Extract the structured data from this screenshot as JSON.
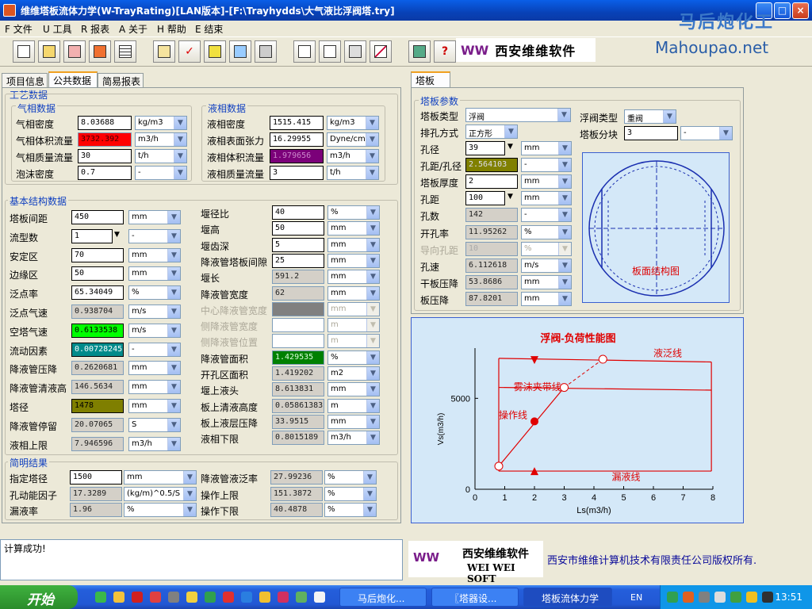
{
  "window": {
    "title": "维维塔板流体力学(W-TrayRating)[LAN版本]-[F:\\Trayhydds\\大气液比浮阀塔.try]",
    "btn_min": "_",
    "btn_max": "□",
    "btn_close": "×"
  },
  "watermark": {
    "line1": "马后炮化工",
    "line2": "Mahoupao.net"
  },
  "menu": [
    {
      "label": "F 文件"
    },
    {
      "label": "U 工具"
    },
    {
      "label": "R 报表"
    },
    {
      "label": "A 关于"
    },
    {
      "label": "H 帮助"
    },
    {
      "label": "E 结束"
    }
  ],
  "toolbar": {
    "icons": [
      "new-file-icon",
      "open-folder-icon",
      "print-file-icon",
      "export-icon",
      "table-icon",
      "load-icon",
      "check-icon",
      "settings-icon",
      "edit-icon",
      "tools-icon",
      "doc-icon",
      "copy-icon",
      "printer-icon",
      "chart-icon",
      "pen-icon",
      "help-icon"
    ],
    "help_glyph": "?",
    "brand_w": "WW",
    "brand_text": "西安维维软件"
  },
  "left_tabs": [
    {
      "label": "项目信息"
    },
    {
      "label": "公共数据"
    },
    {
      "label": "简易报表"
    }
  ],
  "process": {
    "title": "工艺数据",
    "gas": {
      "title": "气相数据",
      "rows": [
        {
          "label": "气相密度",
          "value": "8.03688",
          "unit": "kg/m3"
        },
        {
          "label": "气相体积流量",
          "value": "3732.392",
          "unit": "m3/h"
        },
        {
          "label": "气相质量流量",
          "value": "30",
          "unit": "t/h"
        },
        {
          "label": "泡沫密度",
          "value": "0.7",
          "unit": "-"
        }
      ]
    },
    "liquid": {
      "title": "液相数据",
      "rows": [
        {
          "label": "液相密度",
          "value": "1515.415",
          "unit": "kg/m3"
        },
        {
          "label": "液相表面张力",
          "value": "16.29955",
          "unit": "Dyne/cm"
        },
        {
          "label": "液相体积流量",
          "value": "1.979656",
          "unit": "m3/h"
        },
        {
          "label": "液相质量流量",
          "value": "3",
          "unit": "t/h"
        }
      ]
    }
  },
  "structure": {
    "title": "基本结构数据",
    "left": [
      {
        "label": "塔板间距",
        "value": "450",
        "unit": "mm"
      },
      {
        "label": "流型数",
        "value": "1",
        "unit": "-"
      },
      {
        "label": "安定区",
        "value": "70",
        "unit": "mm"
      },
      {
        "label": "边缘区",
        "value": "50",
        "unit": "mm"
      },
      {
        "label": "泛点率",
        "value": "65.34049",
        "unit": "%"
      },
      {
        "label": "泛点气速",
        "value": "0.938704",
        "unit": "m/s"
      },
      {
        "label": "空塔气速",
        "value": "0.6133538",
        "unit": "m/s"
      },
      {
        "label": "流动因素",
        "value": "0.007282457",
        "unit": "-"
      },
      {
        "label": "降液管压降",
        "value": "0.2620681",
        "unit": "mm"
      },
      {
        "label": "降液管清液高",
        "value": "146.5634",
        "unit": "mm"
      },
      {
        "label": "塔径",
        "value": "1478",
        "unit": "mm"
      },
      {
        "label": "降液管停留",
        "value": "20.07065",
        "unit": "S"
      },
      {
        "label": "液相上限",
        "value": "7.946596",
        "unit": "m3/h"
      }
    ],
    "right": [
      {
        "label": "堰径比",
        "value": "40",
        "unit": "%"
      },
      {
        "label": "堰高",
        "value": "50",
        "unit": "mm"
      },
      {
        "label": "堰齿深",
        "value": "5",
        "unit": "mm"
      },
      {
        "label": "降液管塔板间隙",
        "value": "25",
        "unit": "mm"
      },
      {
        "label": "堰长",
        "value": "591.2",
        "unit": "mm"
      },
      {
        "label": "降液管宽度",
        "value": "62",
        "unit": "mm"
      },
      {
        "label": "中心降液管宽度",
        "value": "",
        "unit": "mm"
      },
      {
        "label": "侧降液管宽度",
        "value": "",
        "unit": "m"
      },
      {
        "label": "侧降液管位置",
        "value": "",
        "unit": "m"
      },
      {
        "label": "降液管面积",
        "value": "1.429535",
        "unit": "%"
      },
      {
        "label": "开孔区面积",
        "value": "1.419202",
        "unit": "m2"
      },
      {
        "label": "堰上液头",
        "value": "8.613831",
        "unit": "mm"
      },
      {
        "label": "板上清液高度",
        "value": "0.05861383",
        "unit": "m"
      },
      {
        "label": "板上液层压降",
        "value": "33.9515",
        "unit": "mm"
      },
      {
        "label": "液相下限",
        "value": "0.8015189",
        "unit": "m3/h"
      }
    ]
  },
  "summary": {
    "title": "简明结果",
    "left": [
      {
        "label": "指定塔径",
        "value": "1500",
        "unit": "mm"
      },
      {
        "label": "孔动能因子",
        "value": "17.3289",
        "unit": "(kg/m)^0.5/S"
      },
      {
        "label": "漏液率",
        "value": "1.96",
        "unit": "%"
      }
    ],
    "right": [
      {
        "label": "降液管液泛率",
        "value": "27.99236",
        "unit": "%"
      },
      {
        "label": "操作上限",
        "value": "151.3872",
        "unit": "%"
      },
      {
        "label": "操作下限",
        "value": "40.4878",
        "unit": "%"
      }
    ]
  },
  "tray": {
    "tab": "塔板",
    "title": "塔板参数",
    "tray_type_label": "塔板类型",
    "tray_type": "浮阀",
    "valve_type_label": "浮阀类型",
    "valve_type": "重阀",
    "layout_label": "排孔方式",
    "layout": "正方形",
    "blocks_label": "塔板分块",
    "blocks": "3",
    "blocks_unit": "-",
    "rows": [
      {
        "label": "孔径",
        "value": "39",
        "unit": "mm"
      },
      {
        "label": "孔距/孔径",
        "value": "2.564103",
        "unit": "-"
      },
      {
        "label": "塔板厚度",
        "value": "2",
        "unit": "mm"
      },
      {
        "label": "孔距",
        "value": "100",
        "unit": "mm"
      },
      {
        "label": "孔数",
        "value": "142",
        "unit": "-"
      },
      {
        "label": "开孔率",
        "value": "11.95262",
        "unit": "%"
      },
      {
        "label": "导向孔距",
        "value": "10",
        "unit": "%"
      },
      {
        "label": "孔速",
        "value": "6.112618",
        "unit": "m/s"
      },
      {
        "label": "干板压降",
        "value": "53.8686",
        "unit": "mm"
      },
      {
        "label": "板压降",
        "value": "87.8201",
        "unit": "mm"
      }
    ],
    "diagram_label": "板面结构图"
  },
  "chart_data": {
    "type": "line",
    "title": "浮阀-负荷性能图",
    "xlabel": "Ls(m3/h)",
    "ylabel": "Vs(m3/h)",
    "xlim": [
      0,
      8
    ],
    "ylim": [
      0,
      7500
    ],
    "xticks": [
      0,
      1,
      2,
      3,
      4,
      5,
      6,
      7,
      8
    ],
    "yticks": [
      0,
      5000
    ],
    "series": [
      {
        "name": "液泛线",
        "x": [
          0.8,
          7.95
        ],
        "y": [
          7200,
          7000
        ]
      },
      {
        "name": "雾沫夹带线",
        "x": [
          0.8,
          7.95
        ],
        "y": [
          5600,
          5450
        ]
      },
      {
        "name": "漏液线",
        "x": [
          0.8,
          7.95
        ],
        "y": [
          1000,
          1000
        ]
      },
      {
        "name": "操作线",
        "x": [
          0.8,
          3.0
        ],
        "y": [
          1270,
          5600
        ]
      }
    ],
    "extension": {
      "x": [
        3.0,
        4.3
      ],
      "y": [
        5600,
        7150
      ]
    },
    "operating_point": {
      "x": 2.0,
      "y": 3732
    },
    "open_points": [
      {
        "x": 0.8,
        "y": 1270
      },
      {
        "x": 3.0,
        "y": 5600
      },
      {
        "x": 4.3,
        "y": 7150
      }
    ],
    "limit_markers": [
      {
        "x": 2.0,
        "y": 7100,
        "dir": "down"
      },
      {
        "x": 2.0,
        "y": 1000,
        "dir": "up"
      }
    ],
    "vlines": [
      {
        "x": 0.8,
        "y": [
          1000,
          7200
        ]
      },
      {
        "x": 7.95,
        "y": [
          1000,
          7000
        ]
      }
    ],
    "labels": [
      {
        "text": "液泛线",
        "x": 6.0,
        "y": 7300
      },
      {
        "text": "雾沫夹带线",
        "x": 1.3,
        "y": 5450
      },
      {
        "text": "操作线",
        "x": 0.8,
        "y": 3900
      },
      {
        "text": "漏液线",
        "x": 4.6,
        "y": 500
      }
    ],
    "color": "#e00000"
  },
  "status": {
    "text": "计算成功!"
  },
  "footer": {
    "brand_w": "WW",
    "brand_cn": "西安维维软件",
    "brand_en": "WEI WEI SOFT",
    "copyright": "西安市维维计算机技术有限责任公司版权所有."
  },
  "taskbar": {
    "start": "开始",
    "tasks": [
      {
        "label": "马后炮化..."
      },
      {
        "label": "〖塔器设..."
      },
      {
        "label": "塔板流体力学"
      }
    ],
    "lang": "EN",
    "clock": "13:51"
  }
}
